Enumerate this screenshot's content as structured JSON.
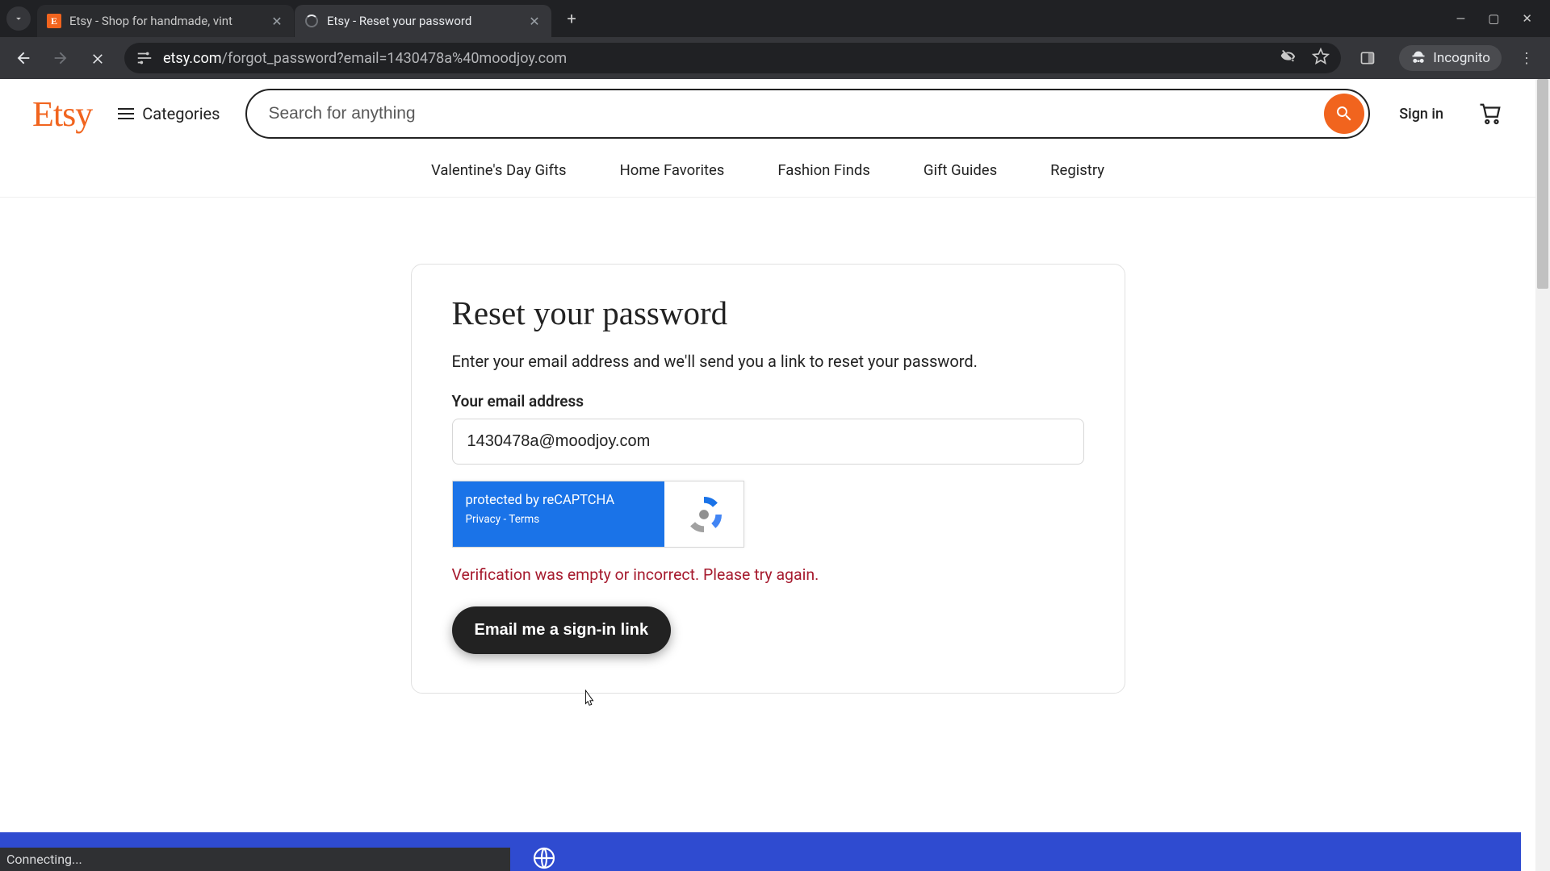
{
  "browser": {
    "tabs": [
      {
        "title": "Etsy - Shop for handmade, vint"
      },
      {
        "title": "Etsy - Reset your password"
      }
    ],
    "url_host": "etsy.com",
    "url_path": "/forgot_password?email=1430478a%40moodjoy.com",
    "incognito_label": "Incognito",
    "status_text": "Connecting..."
  },
  "header": {
    "logo_text": "Etsy",
    "categories_label": "Categories",
    "search_placeholder": "Search for anything",
    "signin_label": "Sign in"
  },
  "catnav": {
    "items": [
      "Valentine's Day Gifts",
      "Home Favorites",
      "Fashion Finds",
      "Gift Guides",
      "Registry"
    ]
  },
  "form": {
    "heading": "Reset your password",
    "instruction": "Enter your email address and we'll send you a link to reset your password.",
    "email_label": "Your email address",
    "email_value": "1430478a@moodjoy.com",
    "recaptcha_text": "protected by reCAPTCHA",
    "recaptcha_privacy": "Privacy",
    "recaptcha_sep": " - ",
    "recaptcha_terms": "Terms",
    "error_text": "Verification was empty or incorrect. Please try again.",
    "submit_label": "Email me a sign-in link"
  }
}
